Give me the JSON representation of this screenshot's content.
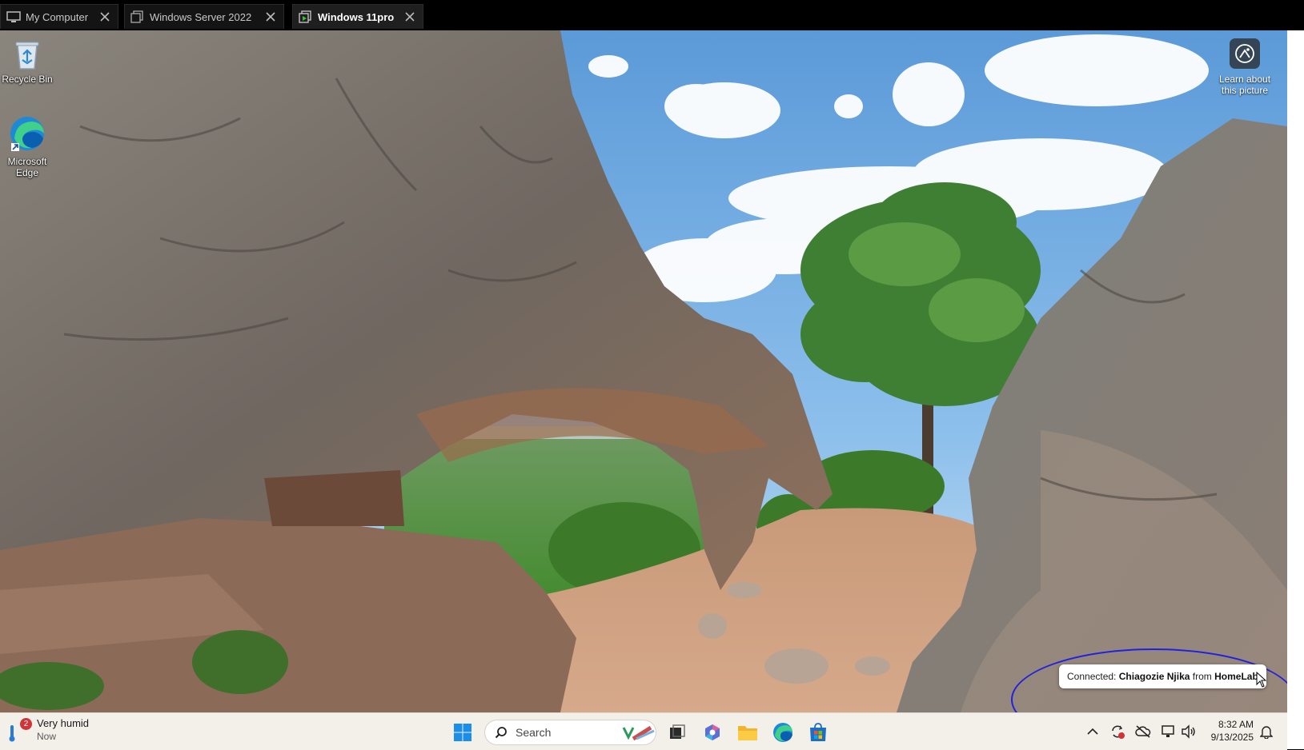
{
  "tabs": [
    {
      "label": "My Computer",
      "icon": "monitor-icon",
      "active": false
    },
    {
      "label": "Windows Server 2022",
      "icon": "window-icon",
      "active": false
    },
    {
      "label": "Windows 11pro",
      "icon": "remote-vm-icon",
      "active": true
    }
  ],
  "desktop": {
    "icons": [
      {
        "label": "Recycle Bin",
        "icon": "recycle-bin-icon"
      },
      {
        "label": "Microsoft Edge",
        "icon": "edge-icon"
      }
    ],
    "learn_about": "Learn about this picture",
    "learn_line1": "Learn about",
    "learn_line2": "this picture"
  },
  "toast": {
    "prefix": "Connected: ",
    "user": "Chiagozie Njika",
    "middle": " from ",
    "source": "HomeLab"
  },
  "taskbar": {
    "weather": {
      "title": "Very humid",
      "subtitle": "Now",
      "badge": "2"
    },
    "search_placeholder": "Search",
    "pinned": [
      "start-icon",
      "search-icon",
      "task-view-icon",
      "copilot-icon",
      "file-explorer-icon",
      "edge-icon",
      "store-icon"
    ],
    "tray": [
      "chevron-up-icon",
      "sync-icon",
      "cloud-off-icon",
      "network-icon",
      "volume-icon",
      "notification-bell-icon"
    ],
    "time": "8:32 AM",
    "date": "9/13/2025"
  },
  "colors": {
    "highlight_ring": "#2020e0",
    "taskbar_bg": "#f3efe9",
    "badge": "#d13438"
  }
}
